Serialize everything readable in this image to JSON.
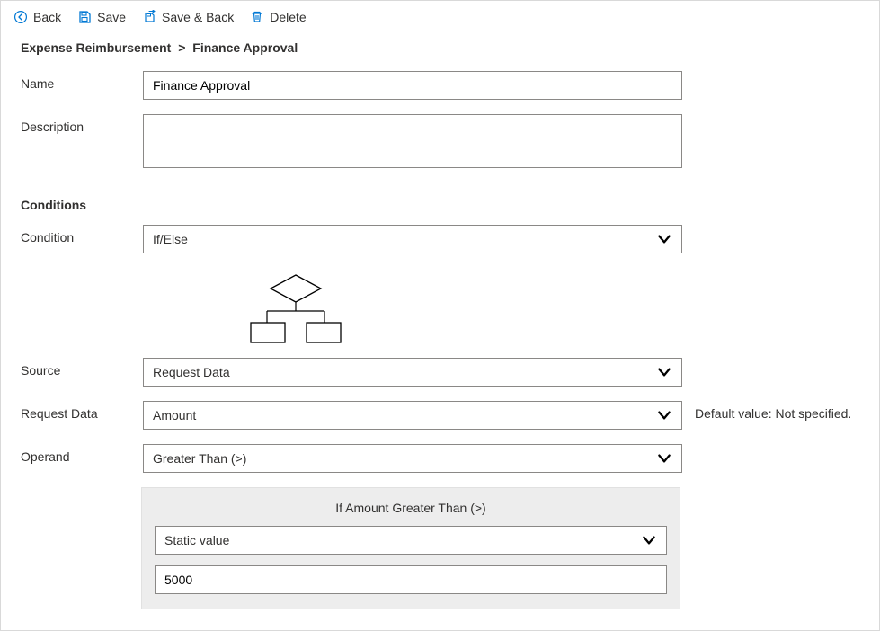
{
  "toolbar": {
    "back": "Back",
    "save": "Save",
    "save_back": "Save & Back",
    "delete": "Delete"
  },
  "breadcrumb": {
    "parent": "Expense Reimbursement",
    "sep": ">",
    "current": "Finance Approval"
  },
  "labels": {
    "name": "Name",
    "description": "Description",
    "conditions": "Conditions",
    "condition": "Condition",
    "source": "Source",
    "request_data": "Request Data",
    "operand": "Operand"
  },
  "fields": {
    "name": "Finance Approval",
    "description": "",
    "condition": "If/Else",
    "source": "Request Data",
    "request_data": "Amount",
    "operand": "Greater Than (>)"
  },
  "hints": {
    "default_value": "Default value: Not specified."
  },
  "condition_block": {
    "title": "If Amount Greater Than (>)",
    "value_type": "Static value",
    "value": "5000"
  }
}
